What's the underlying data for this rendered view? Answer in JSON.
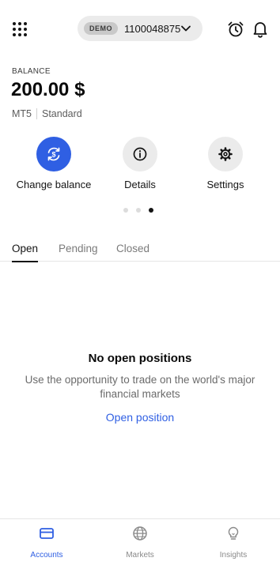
{
  "header": {
    "account_type_badge": "DEMO",
    "account_number": "1100048875",
    "menu_icon": "grid-menu-icon",
    "alarm_icon": "alarm-clock-icon",
    "notifications_icon": "bell-icon"
  },
  "balance": {
    "label": "BALANCE",
    "value": "200.00 $",
    "platform": "MT5",
    "account_kind": "Standard"
  },
  "actions": [
    {
      "label": "Change balance",
      "icon": "change-balance-icon"
    },
    {
      "label": "Details",
      "icon": "info-icon"
    },
    {
      "label": "Settings",
      "icon": "gear-icon"
    }
  ],
  "carousel": {
    "page_count": 3,
    "active_page": 3
  },
  "tabs": [
    {
      "label": "Open",
      "active": true
    },
    {
      "label": "Pending",
      "active": false
    },
    {
      "label": "Closed",
      "active": false
    }
  ],
  "empty_state": {
    "title": "No open positions",
    "text": "Use the opportunity to trade on the world's major financial markets",
    "link": "Open position"
  },
  "bottom_nav": [
    {
      "label": "Accounts",
      "icon": "card-icon",
      "active": true
    },
    {
      "label": "Markets",
      "icon": "globe-icon",
      "active": false
    },
    {
      "label": "Insights",
      "icon": "lightbulb-icon",
      "active": false
    }
  ],
  "colors": {
    "accent": "#2f5fe3",
    "text": "#141414",
    "muted": "#6b6b6b",
    "pill_bg": "#ebebeb"
  }
}
